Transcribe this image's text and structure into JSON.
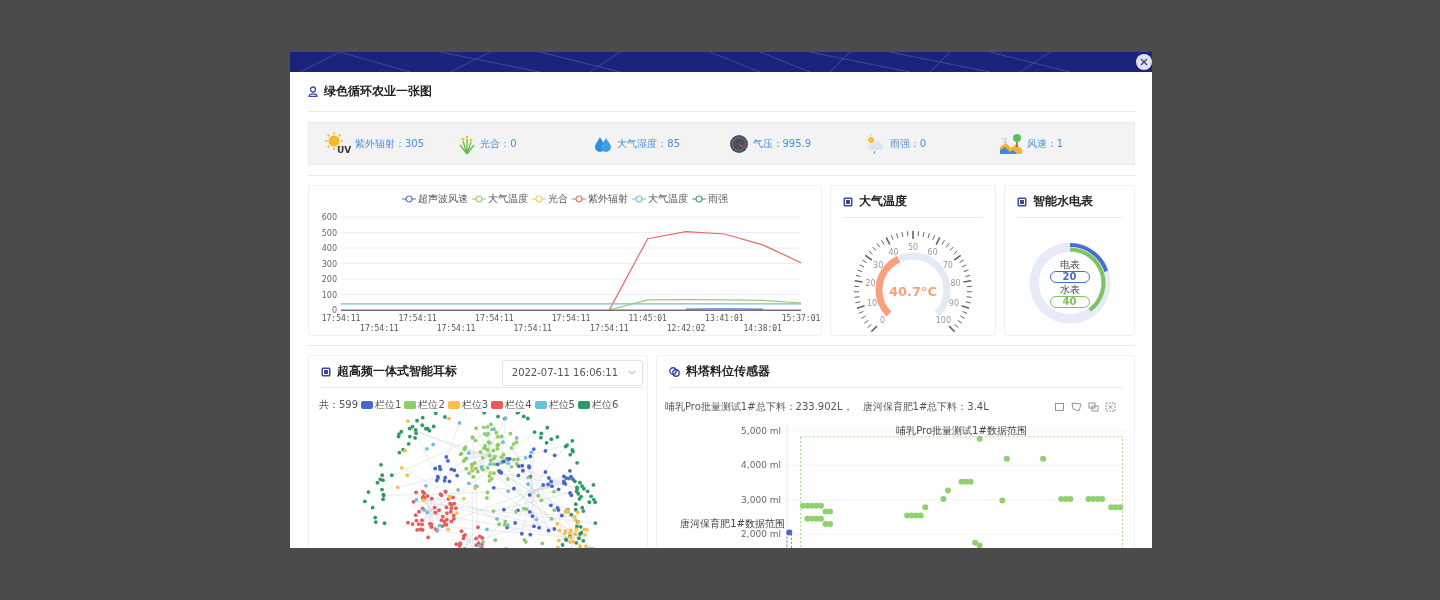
{
  "page_title": "绿色循环农业一张图",
  "stats": [
    {
      "kind": "uv",
      "text": "紫外辐射：305",
      "badge": "UV"
    },
    {
      "kind": "light",
      "text": "光合：0"
    },
    {
      "kind": "humidity",
      "text": "大气湿度：85"
    },
    {
      "kind": "pressure",
      "text": "气压：995.9"
    },
    {
      "kind": "rain",
      "text": "雨强：0"
    },
    {
      "kind": "wind",
      "text": "风速：1"
    }
  ],
  "trend_panel": {
    "chart_data": {
      "type": "line",
      "grid": true,
      "categories": [
        "17:54:11",
        "17:54:11",
        "17:54:11",
        "17:54:11",
        "17:54:11",
        "17:54:11",
        "17:54:11",
        "17:54:11",
        "11:45:01",
        "12:42:02",
        "13:41:01",
        "14:38:01",
        "15:37:01"
      ],
      "yticks": [
        0,
        100,
        200,
        300,
        400,
        500,
        600
      ],
      "ylim": [
        0,
        600
      ],
      "series": [
        {
          "name": "超声波风速",
          "color": "#5470c6",
          "values": [
            null,
            null,
            null,
            null,
            null,
            null,
            null,
            null,
            null,
            6,
            8,
            5,
            null
          ]
        },
        {
          "name": "大气温度",
          "color": "#91cc75",
          "values": [
            null,
            null,
            null,
            null,
            null,
            null,
            null,
            0,
            65,
            67,
            66,
            62,
            45
          ]
        },
        {
          "name": "光合",
          "color": "#fac858",
          "values": [
            null,
            null,
            null,
            null,
            null,
            null,
            null,
            null,
            null,
            null,
            null,
            null,
            null
          ]
        },
        {
          "name": "紫外辐射",
          "color": "#ee6666",
          "values": [
            null,
            null,
            null,
            null,
            null,
            null,
            null,
            0,
            460,
            505,
            490,
            420,
            305
          ]
        },
        {
          "name": "大气温度",
          "color": "#73c0de",
          "values": [
            40,
            40,
            40,
            40,
            40,
            40,
            40,
            40,
            40,
            40,
            40,
            40,
            40
          ]
        },
        {
          "name": "雨强",
          "color": "#3ba272",
          "values": [
            0,
            0,
            0,
            0,
            0,
            0,
            0,
            0,
            0,
            0,
            0,
            0,
            0
          ]
        }
      ]
    }
  },
  "gauge_panel": {
    "title": "大气温度",
    "value_text": "40.7°C",
    "scale": [
      "0",
      "10",
      "20",
      "30",
      "40",
      "50",
      "60",
      "70",
      "80",
      "90",
      "100"
    ]
  },
  "meter_panel": {
    "title": "智能水电表",
    "meters": [
      {
        "label": "电表",
        "value": "20",
        "color": "#4a6bd6"
      },
      {
        "label": "水表",
        "value": "40",
        "color": "#7cc55f"
      }
    ]
  },
  "tag_panel": {
    "title": "超高频一体式智能耳标",
    "date": "2022-07-11 16:06:11",
    "total": "共：599",
    "legend": [
      {
        "label": "栏位1",
        "color": "#4a68c9"
      },
      {
        "label": "栏位2",
        "color": "#8ccc6a"
      },
      {
        "label": "栏位3",
        "color": "#f7c04a"
      },
      {
        "label": "栏位4",
        "color": "#ea5a5a"
      },
      {
        "label": "栏位5",
        "color": "#6cbfdf"
      },
      {
        "label": "栏位6",
        "color": "#2e9a64"
      }
    ]
  },
  "silo_panel": {
    "title": "料塔料位传感器",
    "summary": [
      "哺乳Pro批量测试1#总下料：233.902L，",
      "唐河保育肥1#总下料：3.4L"
    ],
    "chart_data": {
      "type": "scatter",
      "grid": true,
      "ylim": [
        1600,
        5200
      ],
      "yticks": [
        {
          "value": 2000,
          "label": "2,000 ml"
        },
        {
          "value": 3000,
          "label": "3,000 ml"
        },
        {
          "value": 4000,
          "label": "4,000 ml"
        },
        {
          "value": 5000,
          "label": "5,000 ml"
        }
      ],
      "annotations": [
        {
          "text": "哺乳Pro批量测试1#数据范围"
        },
        {
          "text": "唐河保育肥1#数据范围"
        }
      ],
      "categories": [
        null,
        null,
        null,
        null,
        null,
        null,
        null,
        null,
        null,
        null,
        null,
        null,
        null,
        null,
        null,
        null,
        null,
        null,
        null,
        null,
        null,
        null,
        null,
        null,
        null,
        null,
        null,
        null,
        null,
        null,
        null,
        null,
        null,
        null,
        null,
        null,
        null,
        null,
        null,
        null,
        null,
        null,
        null,
        null,
        null,
        null,
        null,
        null,
        null,
        null,
        null,
        null,
        null,
        null,
        null,
        null,
        null,
        null,
        null,
        null,
        null,
        null,
        null,
        null,
        null,
        null,
        null,
        null,
        null,
        null,
        null,
        null,
        null,
        null,
        null
      ],
      "series": [
        {
          "color": "#8fd16f",
          "values": [
            null,
            null,
            null,
            2830,
            2830,
            2830,
            2830,
            2830,
            2660,
            2660,
            null,
            null,
            null,
            null,
            null,
            null,
            null,
            null,
            null,
            null,
            null,
            null,
            null,
            null,
            null,
            null,
            2540,
            2540,
            2540,
            2540,
            2780,
            null,
            null,
            null,
            3020,
            3270,
            null,
            null,
            3520,
            3520,
            3520,
            1750,
            1670,
            null,
            null,
            null,
            null,
            null,
            null,
            null,
            null,
            null,
            null,
            null,
            null,
            null,
            null,
            null,
            null,
            null,
            3020,
            3020,
            3020,
            null,
            null,
            null,
            3020,
            3020,
            3020,
            3020,
            null,
            2780,
            2780,
            2780,
            null
          ]
        },
        {
          "color": "#8fd16f",
          "values": [
            null,
            null,
            null,
            null,
            2450,
            2450,
            2450,
            2450,
            2300,
            2300,
            null,
            null,
            null,
            null,
            null,
            null,
            null,
            null,
            null,
            null,
            null,
            null,
            null,
            null,
            null,
            null,
            null,
            null,
            null,
            null,
            null,
            null,
            null,
            null,
            null,
            null,
            null,
            null,
            null,
            null,
            null,
            null,
            4770,
            null,
            null,
            null,
            null,
            2980,
            4190,
            null,
            null,
            null,
            null,
            null,
            null,
            null,
            4190,
            null,
            null,
            null,
            null,
            null,
            null,
            null,
            null,
            null,
            null,
            null,
            null,
            null,
            null,
            null,
            null,
            null,
            null
          ]
        },
        {
          "color": "#4a68c9",
          "values": [
            2050,
            null,
            null,
            null,
            null,
            null,
            null,
            null,
            null,
            null,
            null,
            null,
            null,
            null,
            null,
            null,
            null,
            null,
            null,
            null,
            null,
            null,
            null,
            null,
            null,
            null,
            null,
            null,
            null,
            null,
            null,
            null,
            null,
            null,
            null,
            null,
            null,
            null,
            null,
            null,
            null,
            null,
            null,
            null,
            null,
            null,
            null,
            null,
            null,
            null,
            null,
            null,
            null,
            null,
            null,
            null,
            null,
            null,
            null,
            null,
            null,
            null,
            null,
            null,
            null,
            null,
            null,
            null,
            null,
            null,
            null,
            null,
            null,
            null,
            null
          ]
        }
      ]
    }
  }
}
